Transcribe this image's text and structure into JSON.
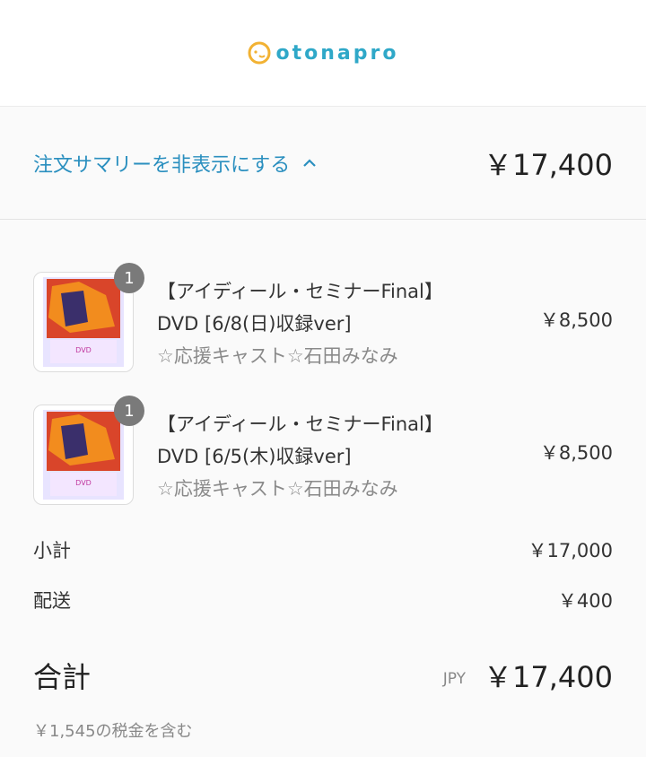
{
  "header": {
    "logo_text": "otonapro"
  },
  "summary_toggle": {
    "label": "注文サマリーを非表示にする",
    "total": "￥17,400"
  },
  "items": [
    {
      "quantity": "1",
      "title": "【アイディール・セミナーFinal】",
      "subtitle": "DVD [6/8(日)収録ver]",
      "variant": "☆応援キャスト☆石田みなみ",
      "price": "￥8,500",
      "thumb_text": "DVD"
    },
    {
      "quantity": "1",
      "title": "【アイディール・セミナーFinal】",
      "subtitle": "DVD [6/5(木)収録ver]",
      "variant": "☆応援キャスト☆石田みなみ",
      "price": "￥8,500",
      "thumb_text": "DVD"
    }
  ],
  "totals": {
    "subtotal_label": "小計",
    "subtotal_value": "￥17,000",
    "shipping_label": "配送",
    "shipping_value": "￥400",
    "total_label": "合計",
    "currency": "JPY",
    "total_value": "￥17,400",
    "tax_note": "￥1,545の税金を含む"
  },
  "colors": {
    "accent": "#2a8fbf",
    "logo": "#2fa8c8",
    "badge": "#7a7a7a"
  }
}
